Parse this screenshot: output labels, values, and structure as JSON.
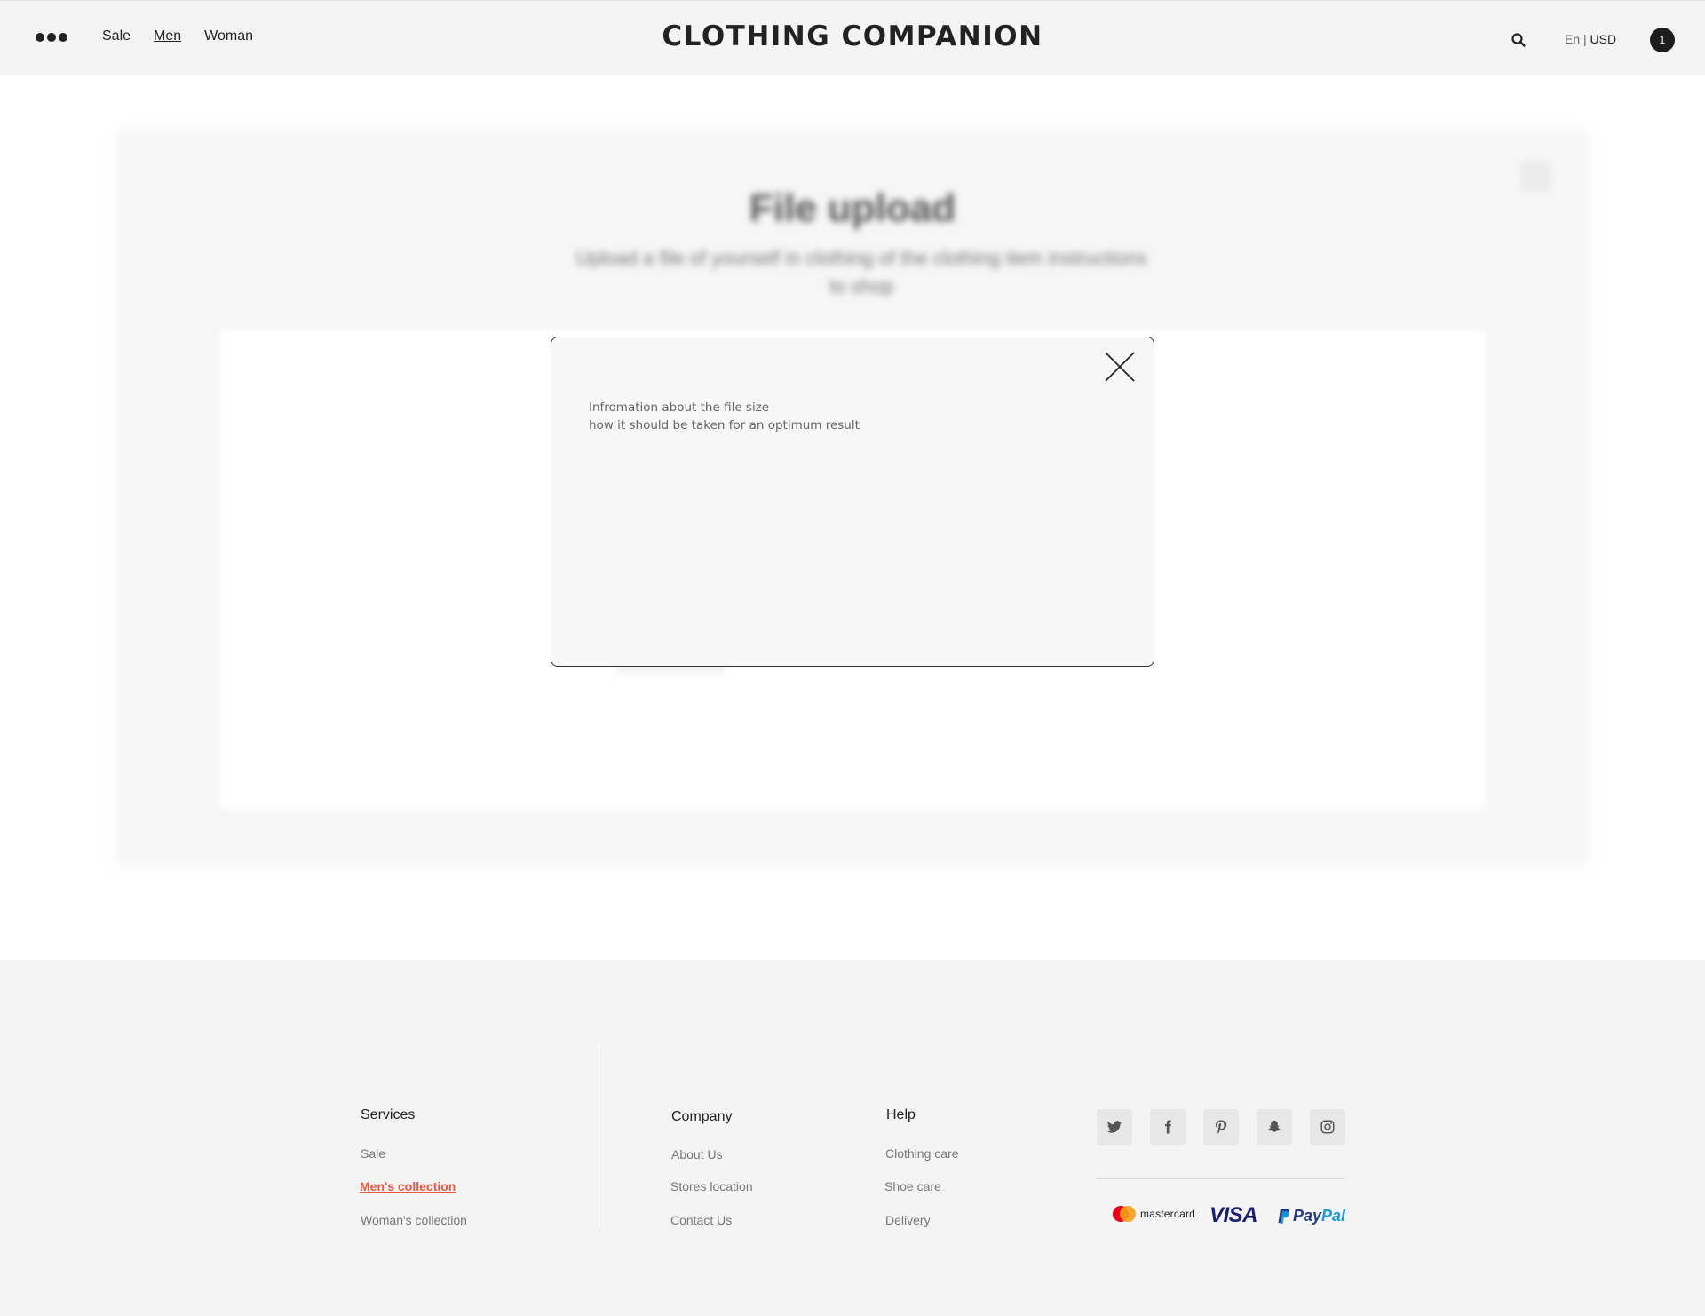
{
  "header": {
    "nav": [
      {
        "label": "Sale"
      },
      {
        "label": "Men"
      },
      {
        "label": "Woman"
      }
    ],
    "logo": "CLOTHING COMPANION",
    "lang": "En",
    "separator": "|",
    "currency": "USD",
    "cart_count": "1"
  },
  "background": {
    "title": "File upload",
    "subtitle": "Upload a file of yourself in clothing of the clothing item instructions to shop"
  },
  "modal": {
    "line1": "Infromation about the file size",
    "line2": "how it should be taken for an optimum result"
  },
  "footer": {
    "services": {
      "heading": "Services",
      "links": [
        "Sale",
        "Men's collection",
        "Woman's collection"
      ]
    },
    "company": {
      "heading": "Company",
      "links": [
        "About Us",
        "Stores location",
        "Contact Us"
      ]
    },
    "help": {
      "heading": "Help",
      "links": [
        "Clothing care",
        "Shoe care",
        "Delivery"
      ]
    },
    "social": [
      "twitter-icon",
      "facebook-icon",
      "pinterest-icon",
      "snapchat-icon",
      "instagram-icon"
    ],
    "payments": {
      "mastercard": "mastercard",
      "visa": "VISA",
      "paypal_1": "Pay",
      "paypal_2": "Pal"
    }
  },
  "colors": {
    "accent": "#e8553f",
    "header_bg": "#f4f4f4",
    "footer_bg": "#f4f4f4",
    "text_dark": "#222222"
  }
}
